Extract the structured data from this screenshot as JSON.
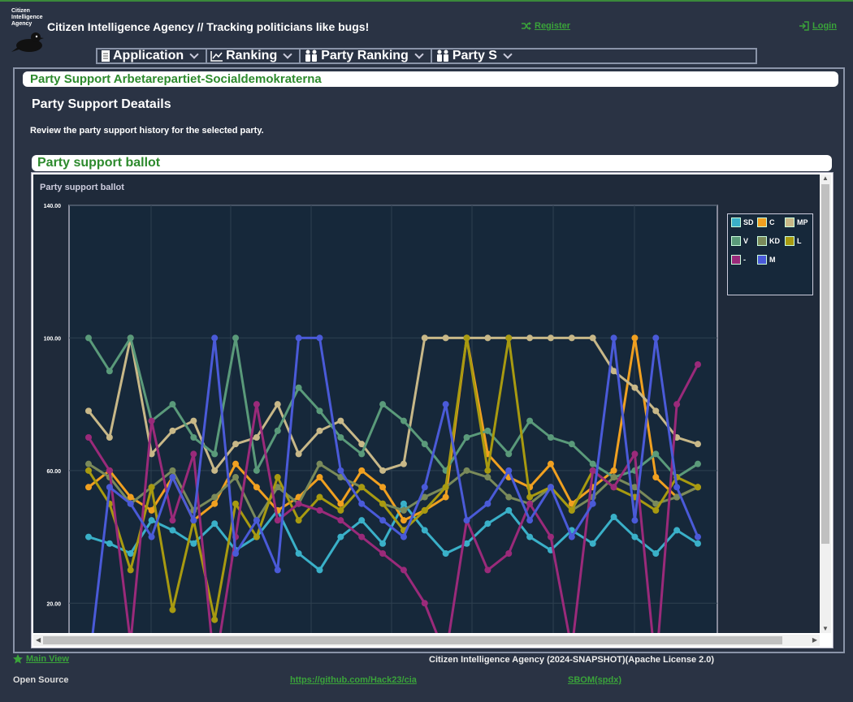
{
  "header": {
    "logo_lines": [
      "Citizen",
      "Intelligence",
      "Agency"
    ],
    "brand": "Citizen Intelligence Agency  // Tracking politicians like bugs!",
    "register": "Register",
    "login": "Login"
  },
  "menu": [
    {
      "label": "Application",
      "icon": "document-icon"
    },
    {
      "label": "Ranking",
      "icon": "chart-line-icon"
    },
    {
      "label": "Party Ranking",
      "icon": "people-icon"
    },
    {
      "label": "Party S",
      "icon": "people-icon"
    }
  ],
  "page": {
    "title": "Party Support Arbetarepartiet-Socialdemokraterna",
    "heading": "Party Support Deatails",
    "description": "Review the party support history for the selected party.",
    "section_title": "Party support ballot"
  },
  "colors": {
    "SD": "#3ab0c8",
    "C": "#f0a020",
    "MP": "#c8b888",
    "V": "#5a9a7a",
    "KD": "#7a8a5a",
    "L": "#a89a10",
    "-": "#9a2a7a",
    "M": "#4a5ad8"
  },
  "chart_data": {
    "type": "line",
    "title": "Party support ballot",
    "ylim": [
      0,
      140
    ],
    "yticks": [
      "20.00",
      "60.00",
      "100.00",
      "140.00"
    ],
    "grid": true,
    "legend_position": "top-right",
    "series": [
      {
        "name": "SD",
        "values": [
          40,
          38,
          35,
          45,
          42,
          38,
          44,
          36,
          40,
          48,
          35,
          30,
          40,
          45,
          38,
          50,
          42,
          35,
          38,
          44,
          48,
          40,
          36,
          42,
          38,
          46,
          40,
          35,
          42,
          38
        ]
      },
      {
        "name": "C",
        "values": [
          55,
          60,
          52,
          48,
          58,
          45,
          50,
          62,
          55,
          48,
          52,
          58,
          50,
          60,
          55,
          45,
          48,
          52,
          100,
          65,
          58,
          55,
          62,
          50,
          55,
          60,
          100,
          58,
          52,
          55
        ]
      },
      {
        "name": "MP",
        "values": [
          78,
          70,
          100,
          65,
          72,
          75,
          60,
          68,
          70,
          80,
          65,
          72,
          75,
          68,
          60,
          62,
          100,
          100,
          100,
          100,
          100,
          100,
          100,
          100,
          100,
          90,
          85,
          78,
          70,
          68
        ]
      },
      {
        "name": "V",
        "values": [
          100,
          90,
          100,
          75,
          80,
          70,
          65,
          100,
          60,
          72,
          85,
          78,
          70,
          65,
          80,
          75,
          68,
          60,
          70,
          72,
          65,
          75,
          70,
          68,
          62,
          58,
          60,
          65,
          58,
          62
        ]
      },
      {
        "name": "KD",
        "values": [
          62,
          58,
          50,
          55,
          60,
          48,
          52,
          58,
          45,
          55,
          50,
          62,
          58,
          55,
          50,
          48,
          52,
          55,
          60,
          58,
          52,
          50,
          55,
          48,
          52,
          58,
          55,
          50,
          52,
          55
        ]
      },
      {
        "name": "L",
        "values": [
          60,
          50,
          30,
          55,
          18,
          45,
          15,
          50,
          40,
          58,
          45,
          52,
          48,
          55,
          50,
          42,
          48,
          55,
          100,
          60,
          100,
          52,
          55,
          48,
          60,
          55,
          52,
          48,
          58,
          55
        ]
      },
      {
        "name": "-",
        "values": [
          70,
          60,
          8,
          75,
          45,
          65,
          0,
          40,
          80,
          45,
          50,
          48,
          45,
          40,
          35,
          30,
          20,
          4,
          45,
          30,
          35,
          50,
          40,
          6,
          60,
          55,
          65,
          0,
          80,
          92
        ]
      },
      {
        "name": "M",
        "values": [
          0,
          55,
          50,
          40,
          58,
          45,
          100,
          35,
          45,
          30,
          100,
          100,
          60,
          50,
          45,
          40,
          55,
          80,
          45,
          50,
          60,
          45,
          55,
          40,
          50,
          100,
          45,
          100,
          55,
          40
        ]
      }
    ]
  },
  "footer": {
    "main_view": "Main View",
    "copyright": "Citizen Intelligence Agency (2024-SNAPSHOT)(Apache License 2.0)",
    "open_source": "Open Source",
    "github": "https://github.com/Hack23/cia",
    "sbom": "SBOM(spdx)"
  }
}
